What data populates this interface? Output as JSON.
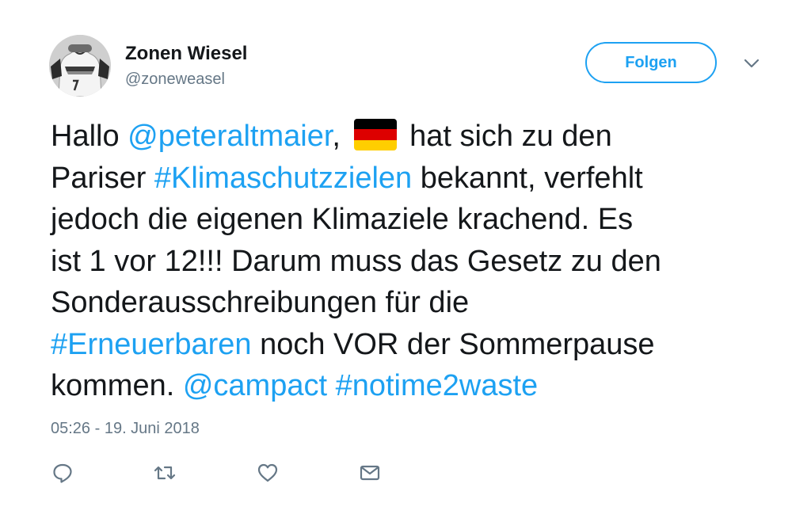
{
  "user": {
    "display_name": "Zonen Wiesel",
    "handle": "@zoneweasel",
    "avatar_icon": "jersey-avatar"
  },
  "follow_button": {
    "label": "Folgen"
  },
  "menu": {
    "icon": "chevron-down-icon"
  },
  "tweet": {
    "l1": {
      "a": "Hallo ",
      "mention": "@peteraltmaier",
      "b": ",",
      "c": " hat sich zu den"
    },
    "l2": {
      "a": "Pariser ",
      "hashtag": "#Klimaschutzzielen",
      "b": " bekannt, verfehlt"
    },
    "l3": {
      "a": "jedoch die eigenen Klimaziele krachend. Es"
    },
    "l4": {
      "a": "ist 1 vor 12!!! Darum muss das Gesetz zu den"
    },
    "l5": {
      "a": "Sonderausschreibungen für die"
    },
    "l6": {
      "hashtag": "#Erneuerbaren",
      "a": " noch VOR der Sommerpause"
    },
    "l7": {
      "a": "kommen. ",
      "mention": "@campact",
      "hashtag": "#notime2waste"
    },
    "flag_colors": [
      "#000000",
      "#dd0000",
      "#ffce00"
    ]
  },
  "timestamp": "05:26 - 19. Juni 2018",
  "actions": {
    "reply_icon": "reply-icon",
    "retweet_icon": "retweet-icon",
    "like_icon": "heart-icon",
    "message_icon": "envelope-icon"
  },
  "colors": {
    "accent": "#1da1f2",
    "text": "#14171a",
    "secondary": "#657786"
  }
}
